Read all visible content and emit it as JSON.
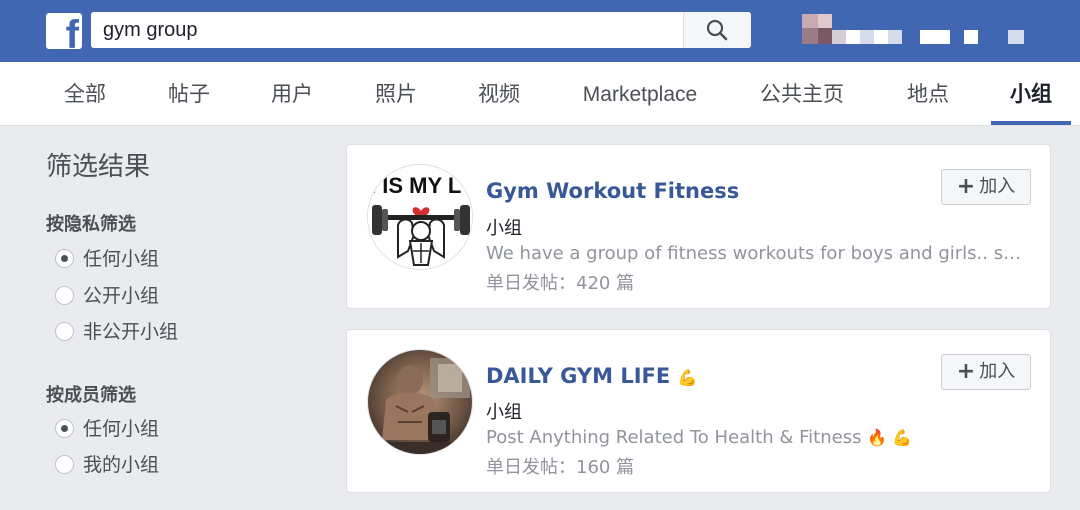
{
  "header": {
    "logo_letter": "f",
    "search_value": "gym group",
    "brand_color": "#4267b2"
  },
  "nav": {
    "tabs": [
      "全部",
      "帖子",
      "用户",
      "照片",
      "视频",
      "Marketplace",
      "公共主页",
      "地点",
      "小组"
    ],
    "active_tab": "小组"
  },
  "sidebar": {
    "title": "筛选结果",
    "privacy_filter": {
      "heading": "按隐私筛选",
      "options": [
        "任何小组",
        "公开小组",
        "非公开小组"
      ],
      "selected": "任何小组"
    },
    "member_filter": {
      "heading": "按成员筛选",
      "options": [
        "任何小组",
        "我的小组"
      ],
      "selected": "任何小组"
    }
  },
  "results": [
    {
      "title": "Gym Workout Fitness",
      "avatar_text": "I IS MY L",
      "type": "小组",
      "description": "We have a group of fitness workouts for boys and girls.. share ...",
      "stat": "单日发帖：420 篇",
      "join_label": "加入"
    },
    {
      "title": "DAILY GYM LIFE",
      "title_emoji": "💪",
      "type": "小组",
      "description": "Post Anything Related To Health & Fitness",
      "description_emoji": "🔥 💪",
      "stat": "单日发帖：160 篇",
      "join_label": "加入"
    }
  ]
}
